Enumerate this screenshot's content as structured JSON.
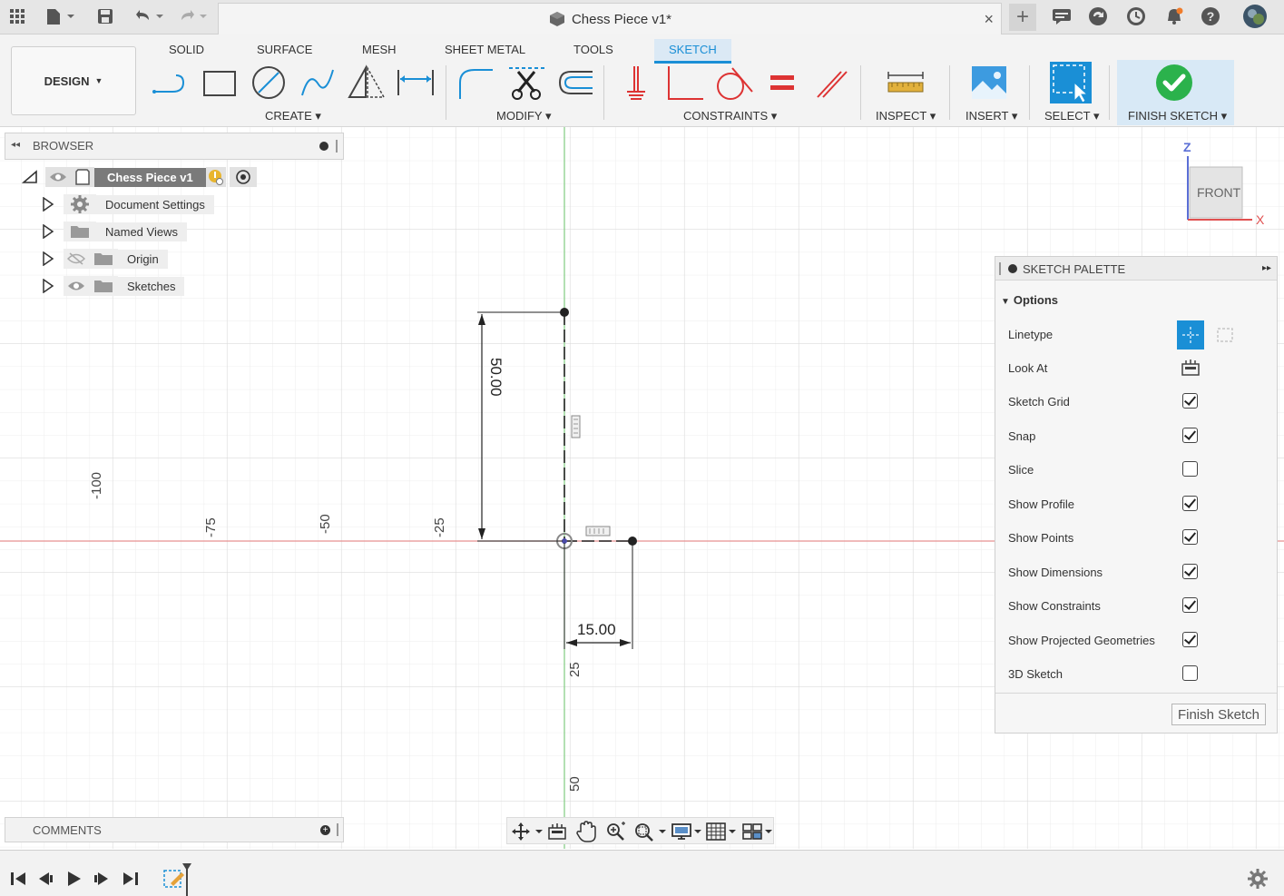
{
  "titlebar": {
    "document_title": "Chess Piece v1*",
    "close_glyph": "×",
    "plus_glyph": "+"
  },
  "ribbon": {
    "workspace_label": "DESIGN",
    "tabs": [
      "SOLID",
      "SURFACE",
      "MESH",
      "SHEET METAL",
      "TOOLS",
      "SKETCH"
    ],
    "active_tab": "SKETCH",
    "groups": {
      "create": "CREATE",
      "modify": "MODIFY",
      "constraints": "CONSTRAINTS",
      "inspect": "INSPECT",
      "insert": "INSERT",
      "select": "SELECT",
      "finish": "FINISH SKETCH"
    },
    "accent_color": "#1a8fd6",
    "finish_color": "#2bb24c"
  },
  "browser": {
    "header": "BROWSER",
    "root": "Chess Piece v1",
    "items": [
      {
        "label": "Document Settings",
        "icon": "gear-icon"
      },
      {
        "label": "Named Views",
        "icon": "folder-icon"
      },
      {
        "label": "Origin",
        "icon": "folder-icon"
      },
      {
        "label": "Sketches",
        "icon": "folder-icon"
      }
    ]
  },
  "viewcube": {
    "face": "FRONT",
    "z_axis": "Z",
    "x_axis": "X"
  },
  "canvas": {
    "axis_labels": [
      "-100",
      "-75",
      "-50",
      "-25",
      "25",
      "50"
    ],
    "dimension_vertical": "50.00",
    "dimension_horizontal": "15.00"
  },
  "palette": {
    "title": "SKETCH PALETTE",
    "section": "Options",
    "rows": [
      {
        "label": "Linetype",
        "kind": "linetype"
      },
      {
        "label": "Look At",
        "kind": "lookat"
      },
      {
        "label": "Sketch Grid",
        "checked": true
      },
      {
        "label": "Snap",
        "checked": true
      },
      {
        "label": "Slice",
        "checked": false
      },
      {
        "label": "Show Profile",
        "checked": true
      },
      {
        "label": "Show Points",
        "checked": true
      },
      {
        "label": "Show Dimensions",
        "checked": true
      },
      {
        "label": "Show Constraints",
        "checked": true
      },
      {
        "label": "Show Projected Geometries",
        "checked": true
      },
      {
        "label": "3D Sketch",
        "checked": false
      }
    ],
    "finish_button": "Finish Sketch"
  },
  "comments": {
    "header": "COMMENTS"
  }
}
